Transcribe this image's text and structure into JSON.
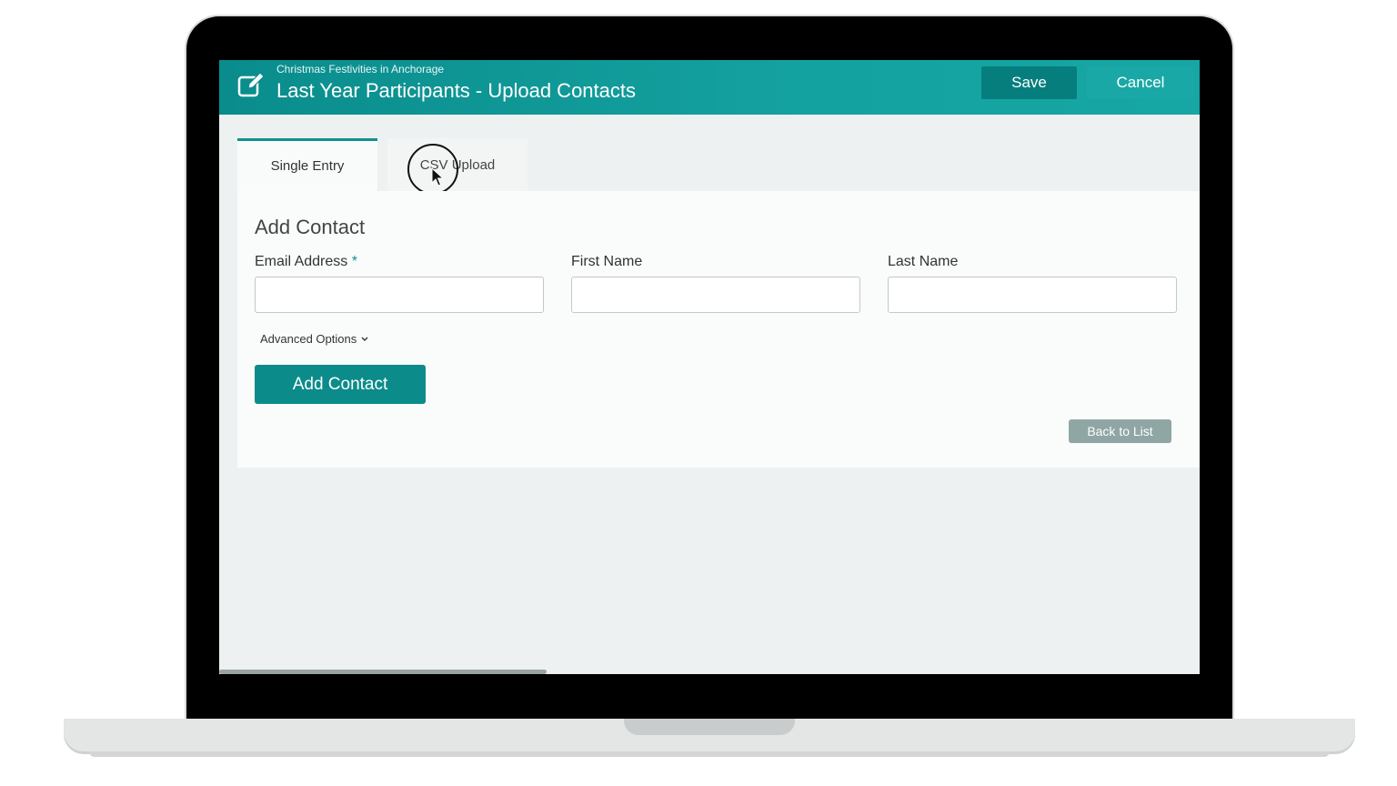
{
  "header": {
    "subtitle": "Christmas Festivities in Anchorage",
    "title": "Last Year Participants - Upload Contacts",
    "save_label": "Save",
    "cancel_label": "Cancel"
  },
  "tabs": [
    {
      "label": "Single Entry",
      "active": true
    },
    {
      "label": "CSV Upload",
      "active": false
    }
  ],
  "form": {
    "heading": "Add Contact",
    "fields": [
      {
        "label": "Email Address",
        "required_mark": "*",
        "value": "",
        "placeholder": ""
      },
      {
        "label": "First Name",
        "value": "",
        "placeholder": ""
      },
      {
        "label": "Last Name",
        "value": "",
        "placeholder": ""
      }
    ],
    "advanced_options_label": "Advanced Options",
    "add_button_label": "Add Contact",
    "back_button_label": "Back to List"
  },
  "colors": {
    "accent": "#0b8c8a",
    "header_start": "#0a8c8c",
    "header_end": "#16a6a4",
    "back_button": "#8fa6a4"
  }
}
